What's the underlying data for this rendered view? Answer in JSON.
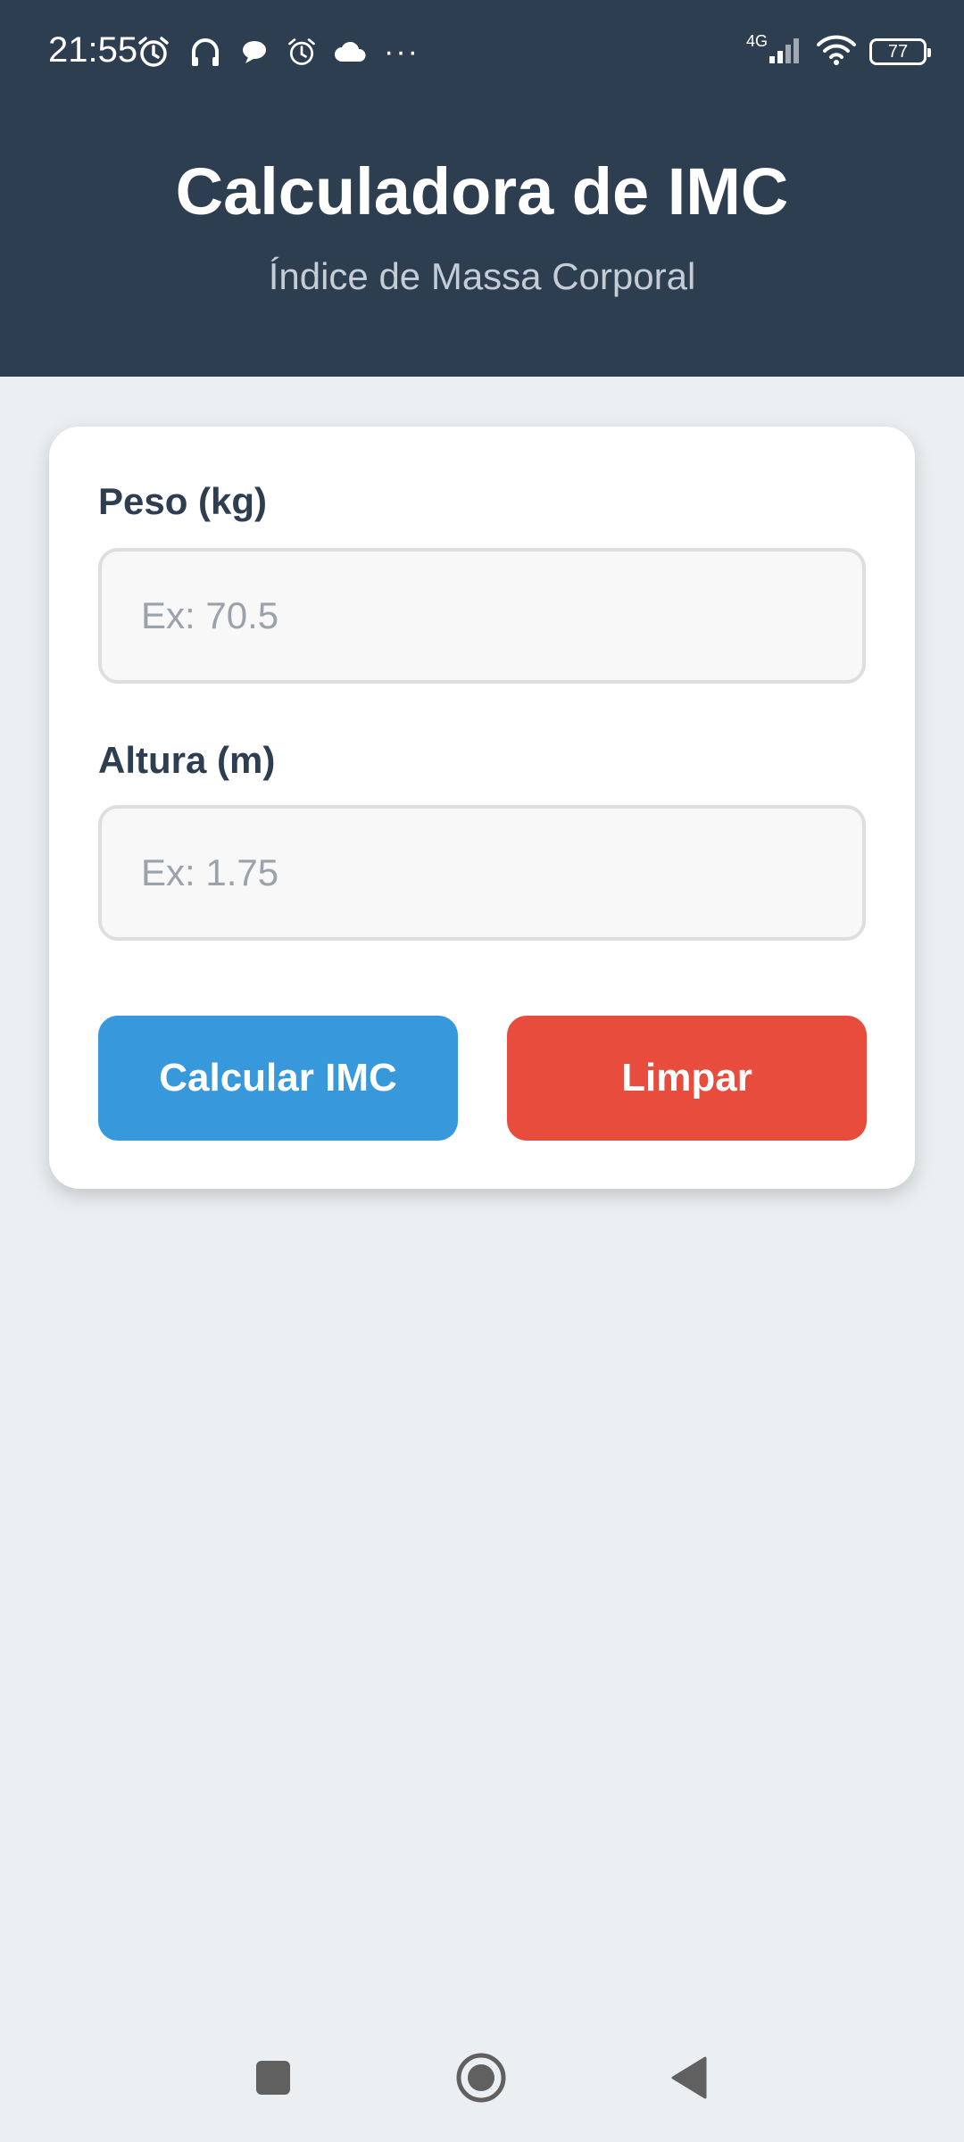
{
  "status_bar": {
    "time": "21:55",
    "network": "4G",
    "battery": "77",
    "overflow": "···"
  },
  "header": {
    "title": "Calculadora de IMC",
    "subtitle": "Índice de Massa Corporal"
  },
  "form": {
    "weight_label": "Peso (kg)",
    "weight_placeholder": "Ex: 70.5",
    "height_label": "Altura (m)",
    "height_placeholder": "Ex: 1.75",
    "calculate_label": "Calcular IMC",
    "clear_label": "Limpar"
  },
  "colors": {
    "header_bg": "#2e3e51",
    "page_bg": "#eceff1",
    "calculate_button": "#3798dc",
    "clear_button": "#e74c3d"
  },
  "nav_icons": [
    "recents-icon",
    "home-icon",
    "back-icon"
  ]
}
